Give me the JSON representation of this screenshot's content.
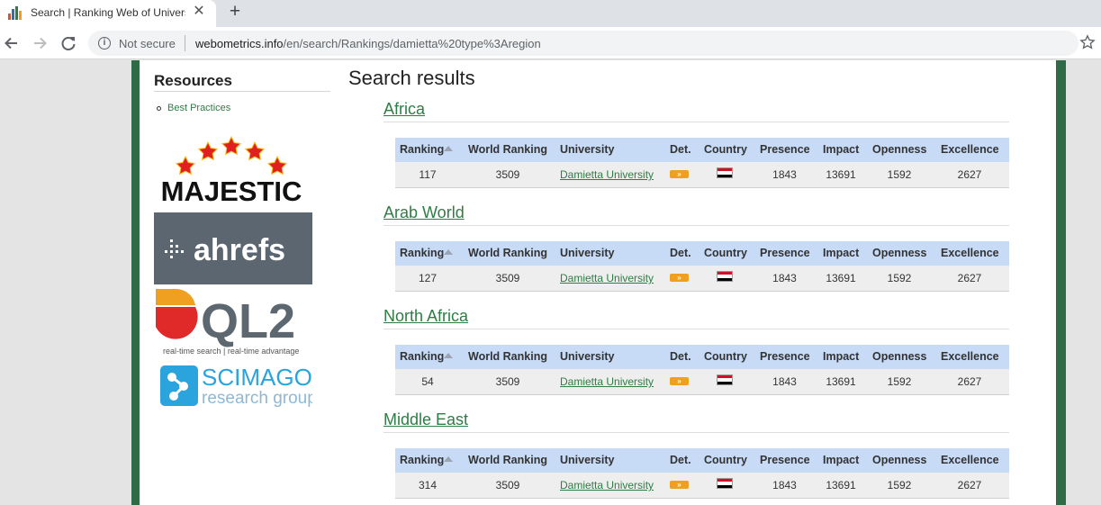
{
  "browser": {
    "tab_title": "Search | Ranking Web of Universities",
    "new_tab": "+",
    "not_secure": "Not secure",
    "url_domain": "webometrics.info",
    "url_path": "/en/search/Rankings/damietta%20type%3Aregion"
  },
  "sidebar": {
    "title": "Resources",
    "links": [
      "Best Practices"
    ],
    "logos": {
      "majestic": "MAJESTIC",
      "ahrefs": "ahrefs",
      "ql2": "QL2",
      "ql2_tagline": "real-time search | real-time advantage",
      "scimago_1": "SCIMAGO",
      "scimago_2": "research group"
    }
  },
  "main": {
    "title": "Search results",
    "columns": [
      "Ranking",
      "World Ranking",
      "University",
      "Det.",
      "Country",
      "Presence",
      "Impact",
      "Openness",
      "Excellence"
    ],
    "det_glyph": "»",
    "sections": [
      {
        "region": "Africa",
        "row": {
          "ranking": "117",
          "world_ranking": "3509",
          "university": "Damietta University",
          "presence": "1843",
          "impact": "13691",
          "openness": "1592",
          "excellence": "2627"
        }
      },
      {
        "region": "Arab World",
        "row": {
          "ranking": "127",
          "world_ranking": "3509",
          "university": "Damietta University",
          "presence": "1843",
          "impact": "13691",
          "openness": "1592",
          "excellence": "2627"
        }
      },
      {
        "region": "North Africa",
        "row": {
          "ranking": "54",
          "world_ranking": "3509",
          "university": "Damietta University",
          "presence": "1843",
          "impact": "13691",
          "openness": "1592",
          "excellence": "2627"
        }
      },
      {
        "region": "Middle East",
        "row": {
          "ranking": "314",
          "world_ranking": "3509",
          "university": "Damietta University",
          "presence": "1843",
          "impact": "13691",
          "openness": "1592",
          "excellence": "2627"
        }
      }
    ]
  },
  "colors": {
    "link": "#2e7d44",
    "frame": "#2e6b46",
    "header_bg": "#c7daf6",
    "det": "#f0a020"
  }
}
